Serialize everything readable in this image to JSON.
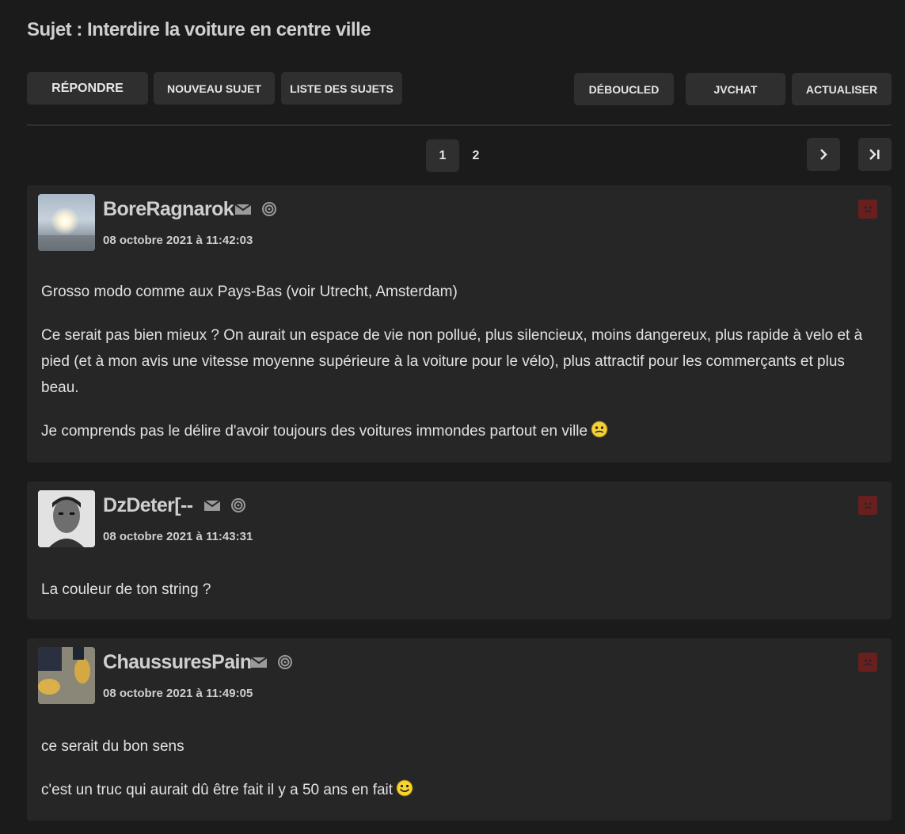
{
  "title": "Sujet : Interdire la voiture en centre ville",
  "toolbar": {
    "reply": "RÉPONDRE",
    "new_topic": "NOUVEAU SUJET",
    "topic_list": "LISTE DES SUJETS",
    "deboucled": "DÉBOUCLED",
    "jvchat": "JVCHAT",
    "refresh": "ACTUALISER"
  },
  "pagination": {
    "pages": [
      "1",
      "2"
    ],
    "current": "1"
  },
  "posts": [
    {
      "author": "BoreRagnarok",
      "date": "08 octobre 2021 à 11:42:03",
      "paragraphs": [
        "Grosso modo comme aux Pays-Bas (voir Utrecht, Amsterdam)",
        "Ce serait pas bien mieux ? On aurait un espace de vie non pollué, plus silencieux, moins dangereux, plus rapide à velo et à pied (et à mon avis une vitesse moyenne supérieure à la voiture pour le vélo), plus attractif pour les commerçants et plus beau.",
        "Je comprends pas le délire d'avoir toujours des voitures immondes partout en ville"
      ]
    },
    {
      "author": "DzDeter[--",
      "date": "08 octobre 2021 à 11:43:31",
      "paragraphs": [
        "La couleur de ton string ?"
      ]
    },
    {
      "author": "ChaussuresPain",
      "date": "08 octobre 2021 à 11:49:05",
      "paragraphs": [
        "ce serait du bon sens",
        "c'est un truc qui aurait dû être fait il y a 50 ans en fait"
      ]
    }
  ],
  "colors": {
    "background": "#1b1b1b",
    "panel": "#262626",
    "button": "#2f2f2f",
    "report": "#6a1f1f"
  }
}
